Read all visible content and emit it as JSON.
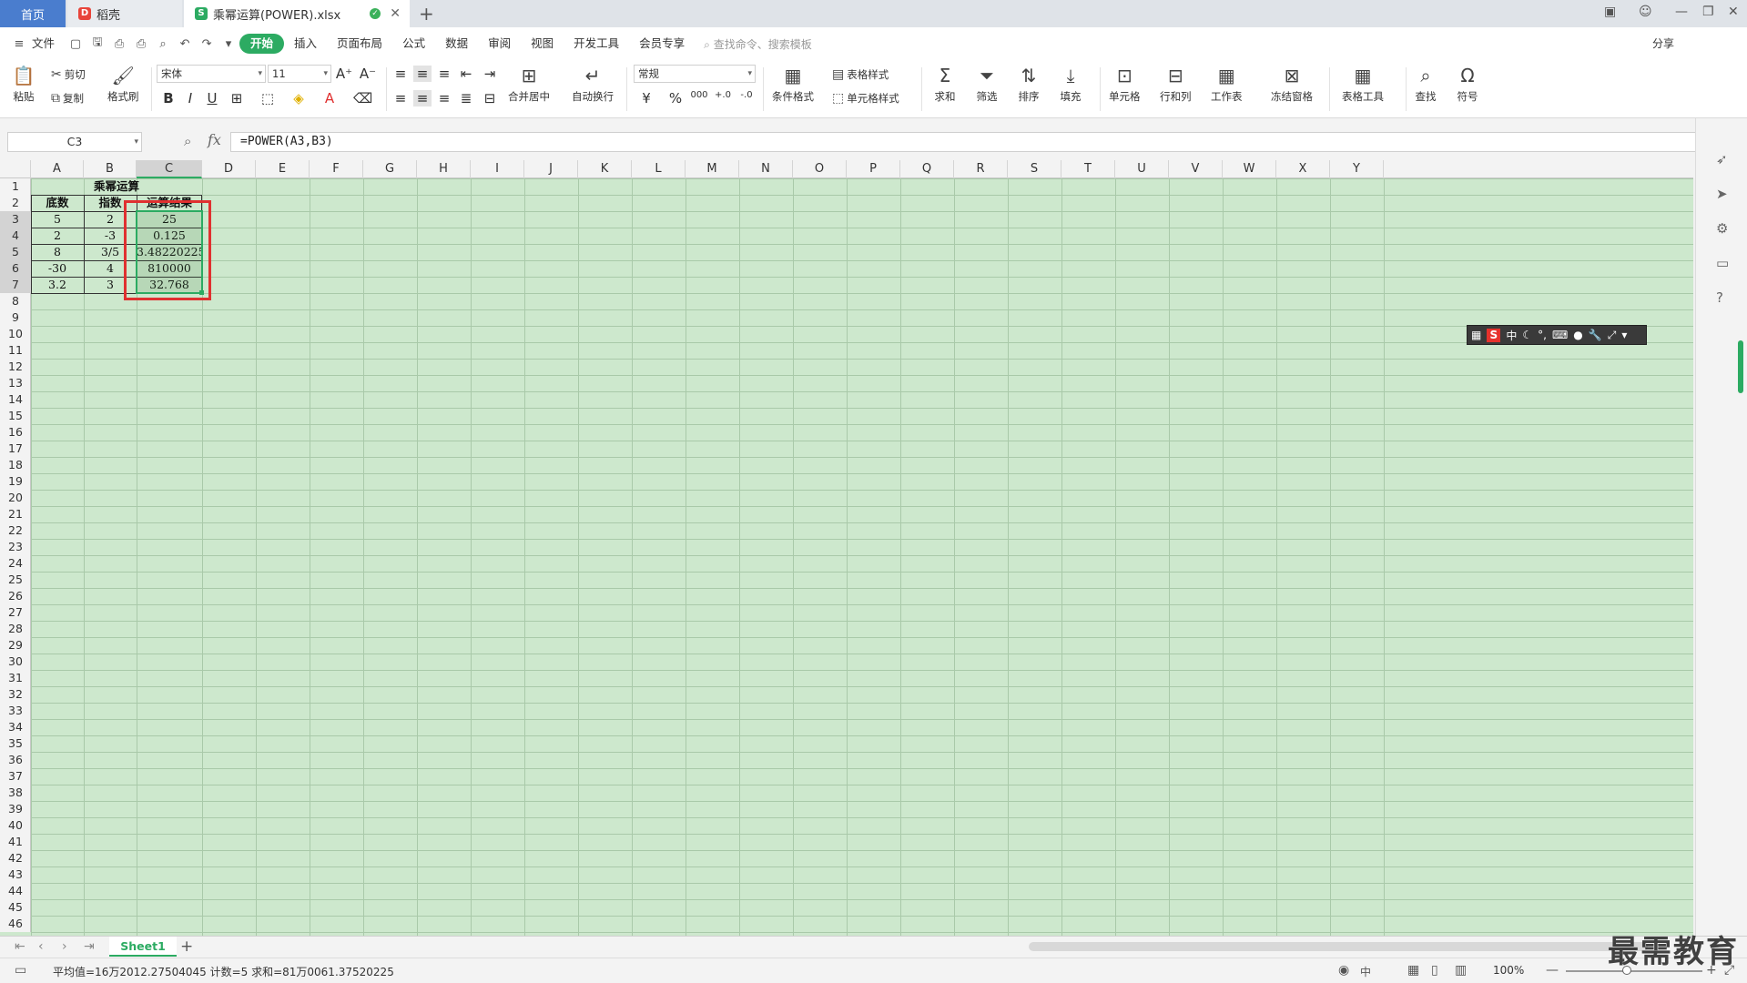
{
  "tabs": {
    "home": "首页",
    "docer": "稻壳",
    "file": "乘幂运算(POWER).xlsx"
  },
  "menu": {
    "file": "文件",
    "items": [
      "开始",
      "插入",
      "页面布局",
      "公式",
      "数据",
      "审阅",
      "视图",
      "开发工具",
      "会员专享"
    ],
    "search_placeholder": "查找命令、搜索模板",
    "share": "分享",
    "cloud_badge": "有同步"
  },
  "ribbon": {
    "paste": "粘贴",
    "cut": "剪切",
    "copy": "复制",
    "format_painter": "格式刷",
    "font_name": "宋体",
    "font_size": "11",
    "merge_center": "合并居中",
    "wrap_text": "自动换行",
    "number_format": "常规",
    "table_style": "表格样式",
    "cell_style": "单元格样式",
    "cond_format": "条件格式",
    "sum": "求和",
    "filter": "筛选",
    "sort": "排序",
    "fill": "填充",
    "cell": "单元格",
    "row_col": "行和列",
    "worksheet": "工作表",
    "freeze": "冻结窗格",
    "table_tools": "表格工具",
    "find": "查找",
    "symbol": "符号"
  },
  "formula_bar": {
    "name_box": "C3",
    "fx": "fx",
    "formula": "=POWER(A3,B3)"
  },
  "columns": [
    "A",
    "B",
    "C",
    "D",
    "E",
    "F",
    "G",
    "H",
    "I",
    "J",
    "K",
    "L",
    "M",
    "N",
    "O",
    "P",
    "Q",
    "R",
    "S",
    "T",
    "U",
    "V",
    "W",
    "X",
    "Y"
  ],
  "row_numbers": [
    "1",
    "2",
    "3",
    "4",
    "5",
    "6",
    "7",
    "8",
    "9",
    "10",
    "11",
    "12",
    "13",
    "14",
    "15",
    "16",
    "17",
    "18",
    "19",
    "20",
    "21",
    "22",
    "23",
    "24",
    "25",
    "26",
    "27",
    "28",
    "29",
    "30",
    "31",
    "32",
    "33",
    "34",
    "35",
    "36",
    "37",
    "38",
    "39",
    "40",
    "41",
    "42",
    "43",
    "44",
    "45",
    "46"
  ],
  "sheet_table": {
    "title": "乘幂运算",
    "headers": [
      "底数",
      "指数",
      "运算结果"
    ],
    "rows": [
      [
        "5",
        "2",
        "25"
      ],
      [
        "2",
        "-3",
        "0.125"
      ],
      [
        "8",
        "3/5",
        "3.48220225"
      ],
      [
        "-30",
        "4",
        "810000"
      ],
      [
        "3.2",
        "3",
        "32.768"
      ]
    ]
  },
  "ime": {
    "lang": "中"
  },
  "sheets": {
    "active": "Sheet1"
  },
  "status": {
    "text": "平均值=16万2012.27504045  计数=5  求和=81万0061.37520225",
    "zoom": "100%",
    "input_mode": "中"
  },
  "watermark": "最需教育",
  "colors": {
    "accent": "#2cab62",
    "grid_bg": "#cde8cd",
    "highlight": "#e03030"
  }
}
